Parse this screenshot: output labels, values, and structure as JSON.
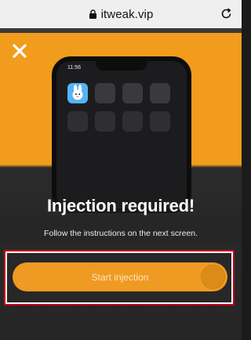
{
  "browser": {
    "url": "itweak.vip",
    "lock_icon": "lock-icon",
    "reload_icon": "reload-icon"
  },
  "modal": {
    "close_icon": "close-icon",
    "phone_time": "11:56",
    "title": "Injection required!",
    "subtitle": "Follow the instructions on the next screen.",
    "cta_label": "Start injection",
    "app_icon": "bunny-app-icon"
  },
  "colors": {
    "accent": "#f29c1d",
    "button": "#ef9a22",
    "highlight": "#c4001a",
    "app_icon_bg": "#53b6f2"
  }
}
